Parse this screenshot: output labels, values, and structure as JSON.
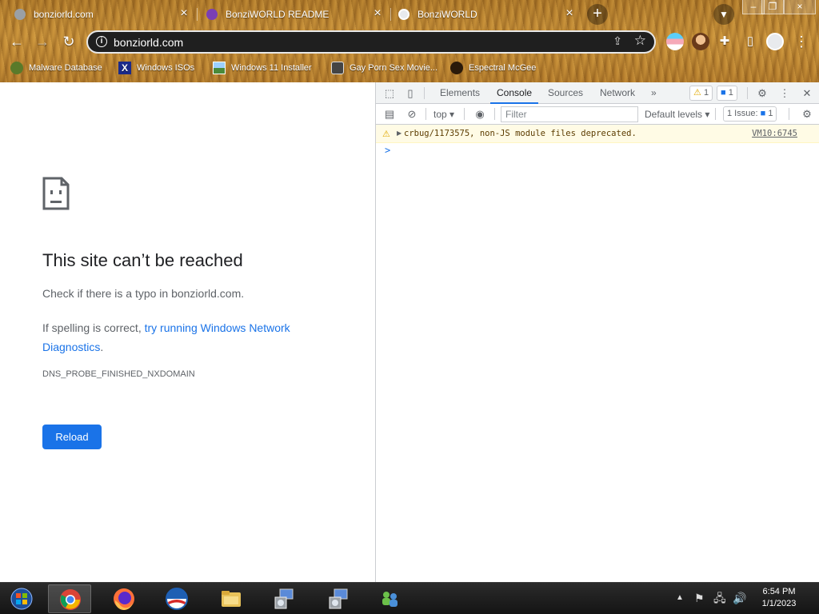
{
  "browser": {
    "tabs": [
      {
        "title": "bonziorld.com",
        "favicon": "globe-icon",
        "active": true
      },
      {
        "title": "BonziWORLD README",
        "favicon": "bonzi-icon",
        "active": false
      },
      {
        "title": "BonziWORLD",
        "favicon": "globe-icon",
        "active": false
      }
    ],
    "address_bar": {
      "url": "bonziorld.com"
    },
    "bookmarks": [
      {
        "label": "Malware Database",
        "icon": "bug-icon"
      },
      {
        "label": "Windows ISOs",
        "icon": "x-logo-icon"
      },
      {
        "label": "Windows 11 Installer",
        "icon": "image-icon"
      },
      {
        "label": "Gay Porn Sex Movie...",
        "icon": "flower-icon"
      },
      {
        "label": "Espectral McGee",
        "icon": "avatar-icon"
      }
    ]
  },
  "error_page": {
    "heading": "This site can’t be reached",
    "line1": "Check if there is a typo in bonziorld.com.",
    "line2_prefix": "If spelling is correct, ",
    "line2_link": "try running Windows Network Diagnostics",
    "line2_suffix": ".",
    "error_code": "DNS_PROBE_FINISHED_NXDOMAIN",
    "reload_label": "Reload"
  },
  "devtools": {
    "tabs": [
      "Elements",
      "Console",
      "Sources",
      "Network"
    ],
    "active_tab": "Console",
    "more_tabs": "»",
    "warnings_count": "1",
    "messages_count": "1",
    "context": "top",
    "filter_placeholder": "Filter",
    "levels_label": "Default levels",
    "issues_label": "1 Issue:",
    "issues_count": "1",
    "console_message": "crbug/1173575, non-JS module files deprecated.",
    "console_source": "VM10:6745",
    "prompt": ">"
  },
  "taskbar": {
    "apps": [
      "start-orb",
      "chrome",
      "firefox",
      "ie",
      "explorer",
      "installer",
      "installer",
      "network"
    ],
    "time": "6:54 PM",
    "date": "1/1/2023"
  },
  "colors": {
    "accent": "#1a73e8",
    "warning_bg": "#fffbe5",
    "chrome_theme": "#c68f38"
  }
}
